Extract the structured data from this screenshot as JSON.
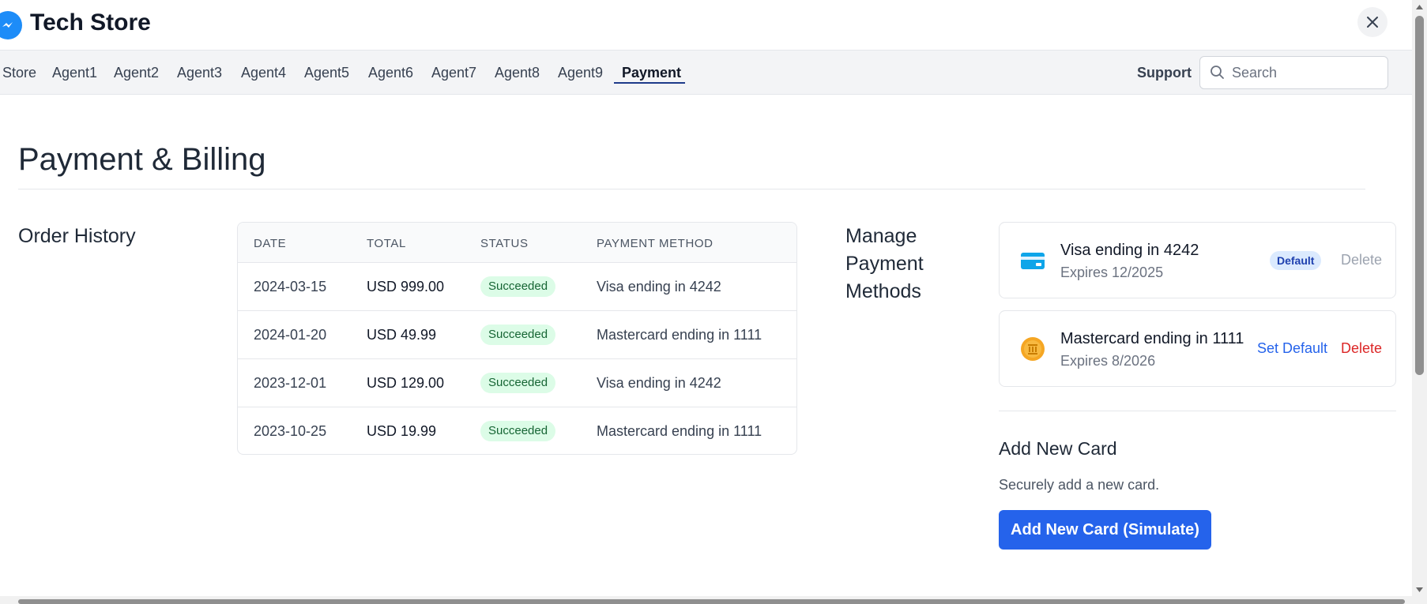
{
  "app": {
    "title": "Tech Store"
  },
  "nav": {
    "items": [
      {
        "label": "Store"
      },
      {
        "label": "Agent1"
      },
      {
        "label": "Agent2"
      },
      {
        "label": "Agent3"
      },
      {
        "label": "Agent4"
      },
      {
        "label": "Agent5"
      },
      {
        "label": "Agent6"
      },
      {
        "label": "Agent7"
      },
      {
        "label": "Agent8"
      },
      {
        "label": "Agent9"
      },
      {
        "label": "Payment",
        "active": true
      }
    ],
    "support_label": "Support",
    "search_placeholder": "Search"
  },
  "page": {
    "title": "Payment & Billing"
  },
  "orders": {
    "heading": "Order History",
    "columns": [
      "DATE",
      "TOTAL",
      "STATUS",
      "PAYMENT METHOD"
    ],
    "rows": [
      {
        "date": "2024-03-15",
        "total": "USD 999.00",
        "status": "Succeeded",
        "method": "Visa ending in 4242"
      },
      {
        "date": "2024-01-20",
        "total": "USD 49.99",
        "status": "Succeeded",
        "method": "Mastercard ending in 1111"
      },
      {
        "date": "2023-12-01",
        "total": "USD 129.00",
        "status": "Succeeded",
        "method": "Visa ending in 4242"
      },
      {
        "date": "2023-10-25",
        "total": "USD 19.99",
        "status": "Succeeded",
        "method": "Mastercard ending in 1111"
      }
    ]
  },
  "payment_methods": {
    "heading_lines": [
      "Manage",
      "Payment",
      "Methods"
    ],
    "cards": [
      {
        "name": "Visa ending in 4242",
        "expires": "Expires 12/2025",
        "icon": "credit-card-icon",
        "default_label": "Default",
        "delete_label": "Delete"
      },
      {
        "name": "Mastercard ending in 1111",
        "expires": "Expires 8/2026",
        "icon": "bank-coin-icon",
        "set_default_label": "Set Default",
        "delete_label": "Delete"
      }
    ],
    "add_card": {
      "heading": "Add New Card",
      "subtitle": "Securely add a new card.",
      "button_label": "Add New Card (Simulate)"
    }
  },
  "colors": {
    "primary": "#2563eb",
    "success_bg": "#dcfce7",
    "success_text": "#166534",
    "danger": "#dc2626",
    "nav_bg": "#f3f4f6"
  }
}
